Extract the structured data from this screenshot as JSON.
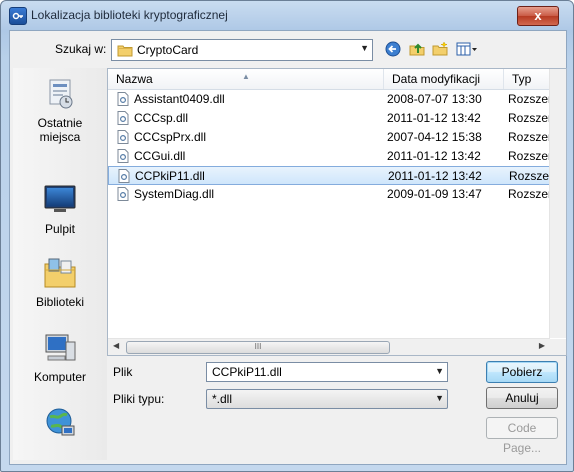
{
  "window": {
    "title": "Lokalizacja biblioteki kryptograficznej",
    "close_glyph": "x"
  },
  "look_in": {
    "label": "Szukaj w:",
    "value": "CryptoCard"
  },
  "places": [
    {
      "label": "Ostatnie miejsca",
      "icon": "recent-places-icon"
    },
    {
      "label": "Pulpit",
      "icon": "desktop-icon"
    },
    {
      "label": "Biblioteki",
      "icon": "libraries-icon"
    },
    {
      "label": "Komputer",
      "icon": "computer-icon"
    },
    {
      "label": "",
      "icon": "network-icon"
    }
  ],
  "columns": {
    "name": "Nazwa",
    "date": "Data modyfikacji",
    "type": "Typ"
  },
  "files": [
    {
      "name": "Assistant0409.dll",
      "date": "2008-07-07 13:30",
      "type": "Rozszerzenie"
    },
    {
      "name": "CCCsp.dll",
      "date": "2011-01-12 13:42",
      "type": "Rozszerzenie"
    },
    {
      "name": "CCCspPrx.dll",
      "date": "2007-04-12 15:38",
      "type": "Rozszerzenie"
    },
    {
      "name": "CCGui.dll",
      "date": "2011-01-12 13:42",
      "type": "Rozszerzenie"
    },
    {
      "name": "CCPkiP11.dll",
      "date": "2011-01-12 13:42",
      "type": "Rozszerzenie",
      "selected": true
    },
    {
      "name": "SystemDiag.dll",
      "date": "2009-01-09 13:47",
      "type": "Rozszerzenie"
    }
  ],
  "scrollbar": {
    "grip": "III"
  },
  "file_name": {
    "label": "Plik",
    "value": "CCPkiP11.dll"
  },
  "file_type": {
    "label": "Pliki typu:",
    "value": "*.dll"
  },
  "buttons": {
    "open": "Pobierz",
    "cancel": "Anuluj",
    "code_page": "Code Page..."
  },
  "colors": {
    "selection": "#cfe6fb",
    "selection_border": "#84acdd",
    "title_bar": "#aec8e6"
  }
}
